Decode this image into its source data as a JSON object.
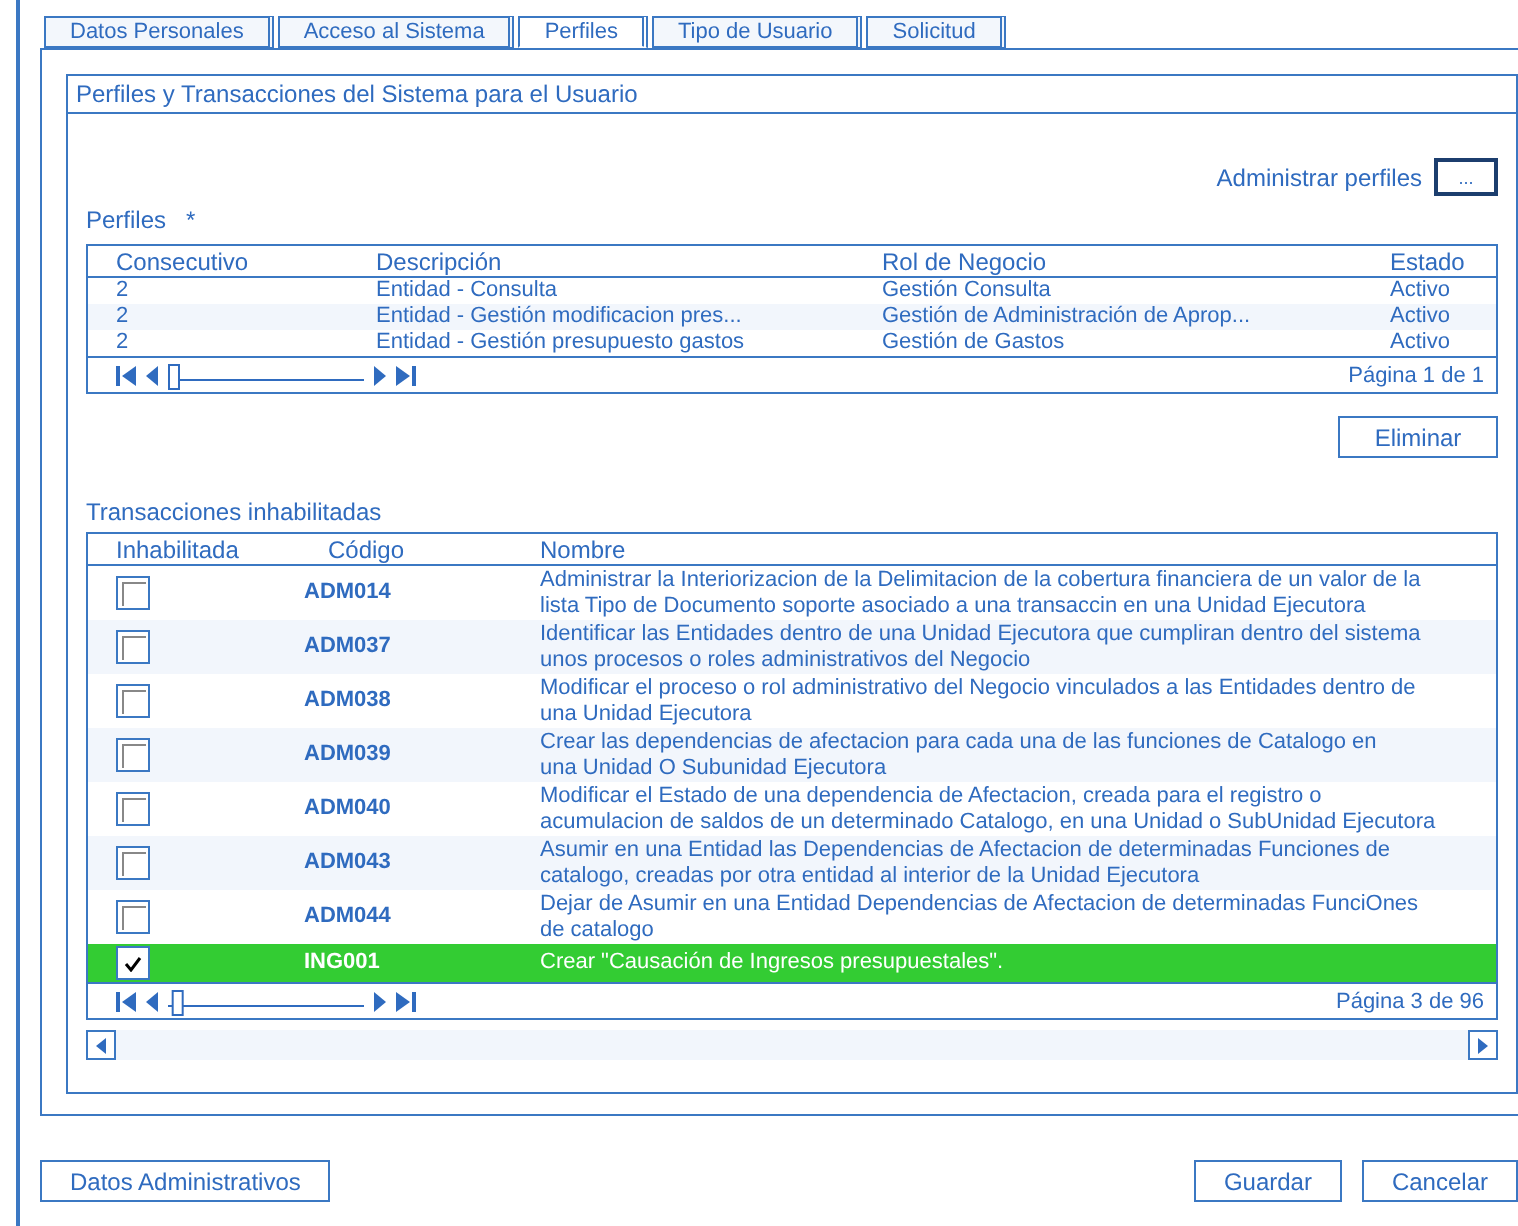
{
  "tabs": [
    {
      "label": "Datos Personales",
      "selected": false
    },
    {
      "label": "Acceso al Sistema",
      "selected": false
    },
    {
      "label": "Perfiles",
      "selected": true
    },
    {
      "label": "Tipo de Usuario",
      "selected": false
    },
    {
      "label": "Solicitud",
      "selected": false
    }
  ],
  "section_title": "Perfiles y Transacciones del Sistema para el Usuario",
  "manage_profiles": {
    "label": "Administrar perfiles",
    "button": "..."
  },
  "profiles": {
    "label": "Perfiles",
    "required_mark": "*",
    "columns": [
      "Consecutivo",
      "Descripción",
      "Rol de Negocio",
      "Estado"
    ],
    "rows": [
      [
        "2",
        "Entidad - Consulta",
        "Gestión Consulta",
        "Activo"
      ],
      [
        "2",
        "Entidad - Gestión modificacion pres...",
        "Gestión de Administración de Aprop...",
        "Activo"
      ],
      [
        "2",
        "Entidad - Gestión presupuesto gastos",
        "Gestión de Gastos",
        "Activo"
      ]
    ],
    "page": "Página 1 de 1",
    "slider": {
      "level": 0
    }
  },
  "delete_button": "Eliminar",
  "transactions": {
    "label": "Transacciones inhabilitadas",
    "columns": [
      "Inhabilitada",
      "Código",
      "Nombre"
    ],
    "rows": [
      {
        "code": "ADM014",
        "name": [
          "Administrar la Interiorizacion de la Delimitacion de la cobertura financiera de un valor de la",
          "lista Tipo de Documento soporte asociado a una transaccin en una Unidad Ejecutora"
        ],
        "checked": false,
        "selected": false
      },
      {
        "code": "ADM037",
        "name": [
          "Identificar las Entidades dentro de una Unidad Ejecutora que cumpliran dentro del sistema",
          "unos procesos o roles administrativos del Negocio"
        ],
        "checked": false,
        "selected": false
      },
      {
        "code": "ADM038",
        "name": [
          "Modificar el proceso o rol administrativo del Negocio vinculados a las Entidades dentro de",
          "una Unidad Ejecutora"
        ],
        "checked": false,
        "selected": false
      },
      {
        "code": "ADM039",
        "name": [
          "Crear las dependencias de afectacion para cada una de las funciones de Catalogo en",
          "una Unidad O Subunidad Ejecutora"
        ],
        "checked": false,
        "selected": false
      },
      {
        "code": "ADM040",
        "name": [
          "Modificar el Estado de una dependencia de Afectacion, creada para el registro o",
          "acumulacion de saldos de un determinado Catalogo, en una Unidad o SubUnidad Ejecutora"
        ],
        "checked": false,
        "selected": false
      },
      {
        "code": "ADM043",
        "name": [
          "Asumir en una Entidad las Dependencias de Afectacion de determinadas Funciones de",
          "catalogo, creadas por otra entidad al interior de la Unidad Ejecutora"
        ],
        "checked": false,
        "selected": false
      },
      {
        "code": "ADM044",
        "name": [
          "Dejar de Asumir en una Entidad Dependencias de Afectacion de determinadas FunciOnes",
          "de catalogo"
        ],
        "checked": false,
        "selected": false
      },
      {
        "code": "ING001",
        "name": [
          "Crear \"Causación de Ingresos presupuestales\"."
        ],
        "checked": true,
        "selected": true
      }
    ],
    "page": "Página 3 de 96",
    "slider": {
      "level": 0.02
    }
  },
  "footer_buttons": {
    "left": "Datos Administrativos",
    "right": [
      "Guardar",
      "Cancelar"
    ]
  }
}
